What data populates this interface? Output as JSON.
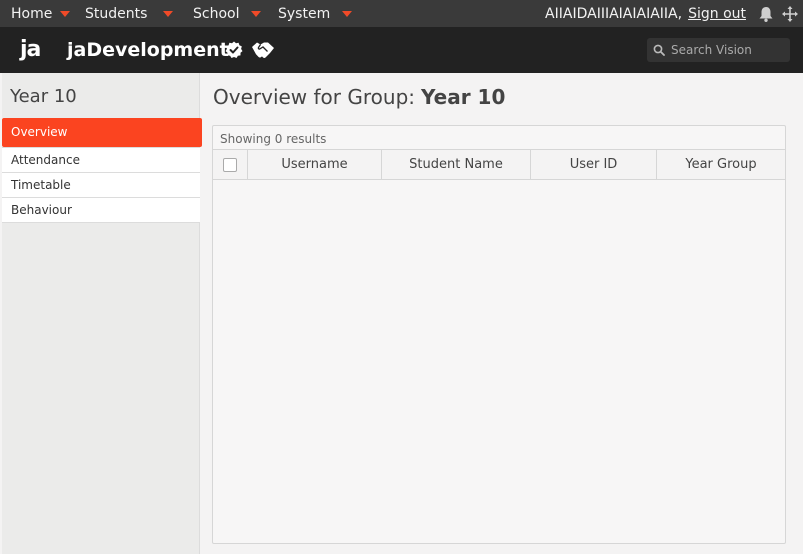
{
  "topbar": {
    "menu": [
      {
        "label": "Home"
      },
      {
        "label": "Students"
      },
      {
        "label": "School"
      },
      {
        "label": "System"
      }
    ],
    "user_name": "AIIAIDAIIIAIAIAIAIIA,",
    "sign_out_label": "Sign out"
  },
  "appbar": {
    "logo_text": "ja",
    "title": "jaDevelopment",
    "search_placeholder": "Search Vision"
  },
  "sidebar": {
    "title": "Year 10",
    "items": [
      {
        "label": "Overview",
        "active": true
      },
      {
        "label": "Attendance"
      },
      {
        "label": "Timetable"
      },
      {
        "label": "Behaviour"
      }
    ]
  },
  "main": {
    "title_prefix": "Overview for Group:",
    "title_group": "Year 10",
    "results_text": "Showing 0 results",
    "columns": [
      "Username",
      "Student Name",
      "User ID",
      "Year Group"
    ]
  },
  "colors": {
    "accent": "#fb4420",
    "topbar_bg": "#3a3a3a",
    "appbar_bg": "#222222"
  }
}
